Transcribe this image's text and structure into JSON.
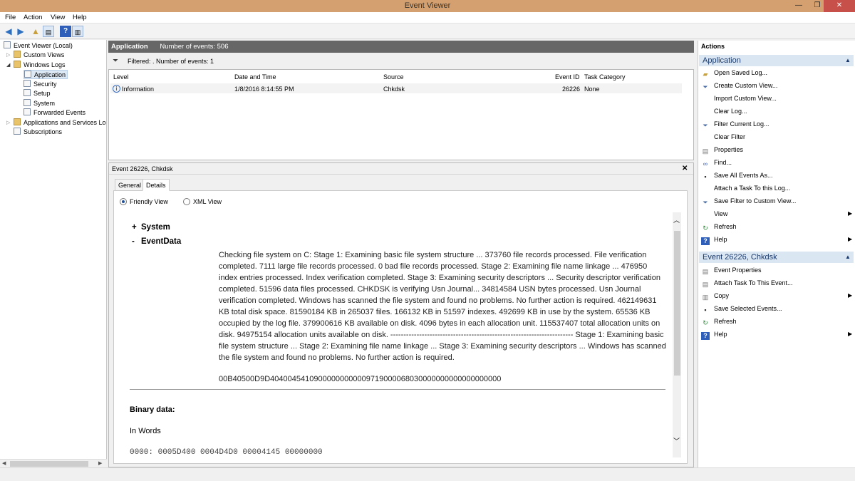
{
  "window": {
    "title": "Event Viewer",
    "minimize": "—",
    "maximize": "❐",
    "close": "✕"
  },
  "menu": [
    "File",
    "Action",
    "View",
    "Help"
  ],
  "tree": {
    "root": "Event Viewer (Local)",
    "custom_views": "Custom Views",
    "windows_logs": "Windows Logs",
    "logs": [
      "Application",
      "Security",
      "Setup",
      "System",
      "Forwarded Events"
    ],
    "apps_services": "Applications and Services Lo",
    "subscriptions": "Subscriptions"
  },
  "header": {
    "log_name": "Application",
    "count_text": "Number of events: 506"
  },
  "filter_text": "Filtered: . Number of events: 1",
  "grid": {
    "columns": [
      "Level",
      "Date and Time",
      "Source",
      "Event ID",
      "Task Category"
    ],
    "row": {
      "level": "Information",
      "date": "1/8/2016 8:14:55 PM",
      "source": "Chkdsk",
      "event_id": "26226",
      "category": "None"
    }
  },
  "detail": {
    "title": "Event 26226, Chkdsk",
    "close": "✕",
    "tabs": [
      "General",
      "Details"
    ],
    "friendly": "Friendly View",
    "xml": "XML View",
    "system_toggle": "+",
    "system": "System",
    "eventdata_toggle": "-",
    "eventdata": "EventData",
    "text": "Checking file system on C: Stage 1: Examining basic file system structure ... 373760 file records processed. File verification completed. 7111 large file records processed. 0 bad file records processed. Stage 2: Examining file name linkage ... 476950 index entries processed. Index verification completed. Stage 3: Examining security descriptors ... Security descriptor verification completed. 51596 data files processed. CHKDSK is verifying Usn Journal... 34814584 USN bytes processed. Usn Journal verification completed. Windows has scanned the file system and found no problems. No further action is required. 462149631 KB total disk space. 81590184 KB in 265037 files. 166132 KB in 51597 indexes. 492699 KB in use by the system. 65536 KB occupied by the log file. 379900616 KB available on disk. 4096 bytes in each allocation unit. 115537407 total allocation units on disk. 94975154 allocation units available on disk. ---------------------------------------------------------------------- Stage 1: Examining basic file system structure ... Stage 2: Examining file name linkage ... Stage 3: Examining security descriptors ... Windows has scanned the file system and found no problems. No further action is required.",
    "hex": "00B40500D9D40400454109000000000009719000068030000000000000000000",
    "binary_label": "Binary data:",
    "in_words": "In Words",
    "partial_line": "0000:  0005D400  0004D4D0  00004145  00000000"
  },
  "actions": {
    "title": "Actions",
    "group1": "Application",
    "items1": [
      "Open Saved Log...",
      "Create Custom View...",
      "Import Custom View...",
      "Clear Log...",
      "Filter Current Log...",
      "Clear Filter",
      "Properties",
      "Find...",
      "Save All Events As...",
      "Attach a Task To this Log...",
      "Save Filter to Custom View...",
      "View",
      "Refresh",
      "Help"
    ],
    "group2": "Event 26226, Chkdsk",
    "items2": [
      "Event Properties",
      "Attach Task To This Event...",
      "Copy",
      "Save Selected Events...",
      "Refresh",
      "Help"
    ]
  }
}
